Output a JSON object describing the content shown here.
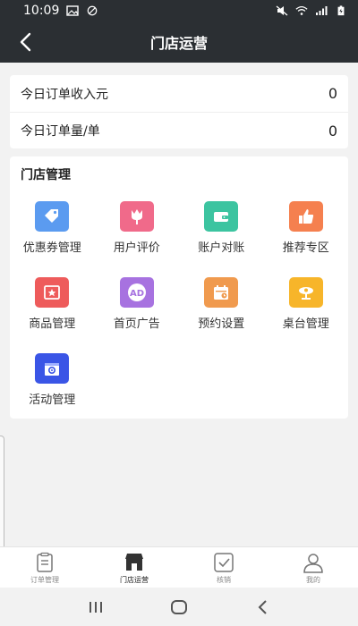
{
  "status_bar": {
    "time": "10:09"
  },
  "nav": {
    "title": "门店运营"
  },
  "stats": [
    {
      "label": "今日订单收入元",
      "value": "0"
    },
    {
      "label": "今日订单量/单",
      "value": "0"
    }
  ],
  "management": {
    "title": "门店管理",
    "items": [
      {
        "label": "优惠券管理",
        "icon": "coupon-icon",
        "color": "#5b9bf0"
      },
      {
        "label": "用户评价",
        "icon": "flower-icon",
        "color": "#f06a8a"
      },
      {
        "label": "账户对账",
        "icon": "wallet-icon",
        "color": "#3cc4a0"
      },
      {
        "label": "推荐专区",
        "icon": "thumbs-up-icon",
        "color": "#f5804f"
      },
      {
        "label": "商品管理",
        "icon": "star-box-icon",
        "color": "#ee5b5b"
      },
      {
        "label": "首页广告",
        "icon": "ad-icon",
        "color": "#a772e0"
      },
      {
        "label": "预约设置",
        "icon": "calendar-icon",
        "color": "#f09a4e"
      },
      {
        "label": "桌台管理",
        "icon": "table-icon",
        "color": "#f7b52a"
      },
      {
        "label": "活动管理",
        "icon": "gift-gear-icon",
        "color": "#3a55e6"
      }
    ]
  },
  "tabs": [
    {
      "label": "订单管理",
      "icon": "order-list-icon",
      "active": false
    },
    {
      "label": "门店运营",
      "icon": "store-icon",
      "active": true
    },
    {
      "label": "核销",
      "icon": "verify-check-icon",
      "active": false
    },
    {
      "label": "我的",
      "icon": "user-icon",
      "active": false
    }
  ]
}
